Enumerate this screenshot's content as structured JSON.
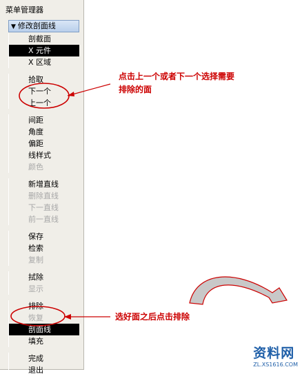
{
  "panel": {
    "title": "菜单管理器"
  },
  "menu": {
    "header": "修改剖面线",
    "items": [
      {
        "label": "剖截面",
        "state": "normal"
      },
      {
        "label": "X 元件",
        "state": "selected"
      },
      {
        "label": "X 区域",
        "state": "normal"
      },
      {
        "label": "拾取",
        "state": "normal"
      },
      {
        "label": "下一个",
        "state": "normal"
      },
      {
        "label": "上一个",
        "state": "normal"
      },
      {
        "label": "间距",
        "state": "normal"
      },
      {
        "label": "角度",
        "state": "normal"
      },
      {
        "label": "偏距",
        "state": "normal"
      },
      {
        "label": "线样式",
        "state": "normal"
      },
      {
        "label": "颜色",
        "state": "disabled"
      },
      {
        "label": "新增直线",
        "state": "normal"
      },
      {
        "label": "删除直线",
        "state": "disabled"
      },
      {
        "label": "下一直线",
        "state": "disabled"
      },
      {
        "label": "前一直线",
        "state": "disabled"
      },
      {
        "label": "保存",
        "state": "normal"
      },
      {
        "label": "检索",
        "state": "normal"
      },
      {
        "label": "复制",
        "state": "disabled"
      },
      {
        "label": "拭除",
        "state": "normal"
      },
      {
        "label": "显示",
        "state": "disabled"
      },
      {
        "label": "排除",
        "state": "normal"
      },
      {
        "label": "恢复",
        "state": "disabled"
      },
      {
        "label": "剖面线",
        "state": "selected"
      },
      {
        "label": "填充",
        "state": "normal"
      },
      {
        "label": "完成",
        "state": "normal"
      },
      {
        "label": "退出",
        "state": "normal"
      }
    ]
  },
  "annotations": {
    "note1_line1": "点击上一个或者下一个选择需要",
    "note1_line2": "排除的面",
    "note2": "选好面之后点击排除"
  },
  "watermark": {
    "main": "资料网",
    "sub": "ZL.XS1616.COM"
  },
  "colors": {
    "annotation": "#cc0000",
    "selected_bg": "#000000",
    "disabled_text": "#a8a8a8",
    "header_bg": "#c8daf0"
  }
}
